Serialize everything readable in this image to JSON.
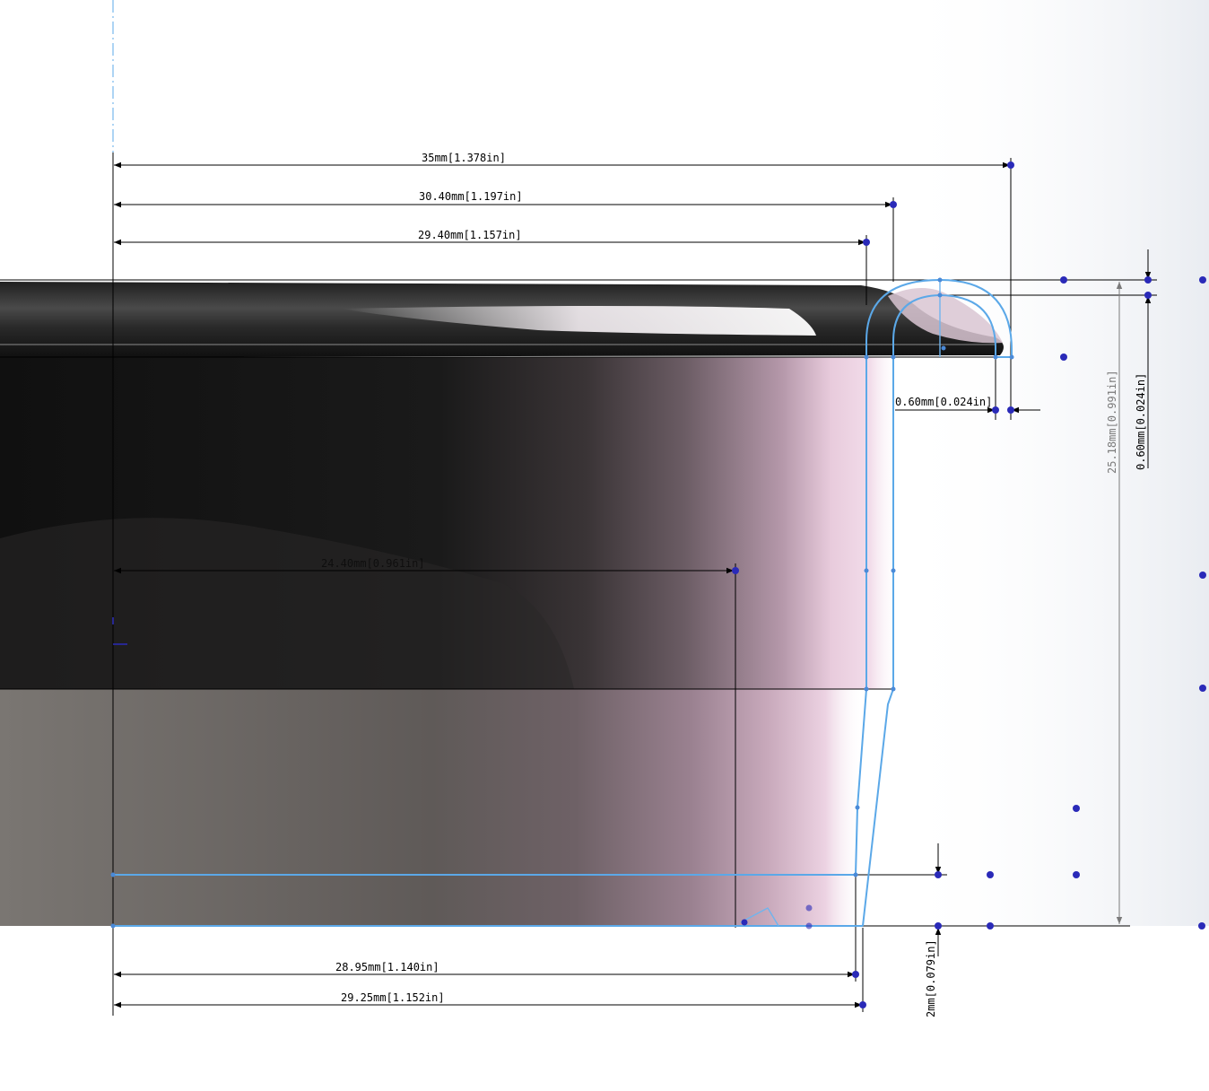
{
  "viewport": {
    "background": "#ffffff",
    "model_dark": "#1a1a1a",
    "model_mid": "#6a6666",
    "model_pink": "#e6c3d8",
    "sketch_color": "#5ba8e8",
    "point_color": "#2a2ab8"
  },
  "dimensions": {
    "d_35": "35mm[1.378in]",
    "d_3040": "30.40mm[1.197in]",
    "d_2940": "29.40mm[1.157in]",
    "d_060h": "0.60mm[0.024in]",
    "d_060v": "0.60mm[0.024in]",
    "d_2518": "25.18mm[0.991in]",
    "d_2895": "28.95mm[1.140in]",
    "d_2925": "29.25mm[1.152in]",
    "d_2": "2mm[0.079in]",
    "d_inner": "24.40mm[0.961in]"
  }
}
